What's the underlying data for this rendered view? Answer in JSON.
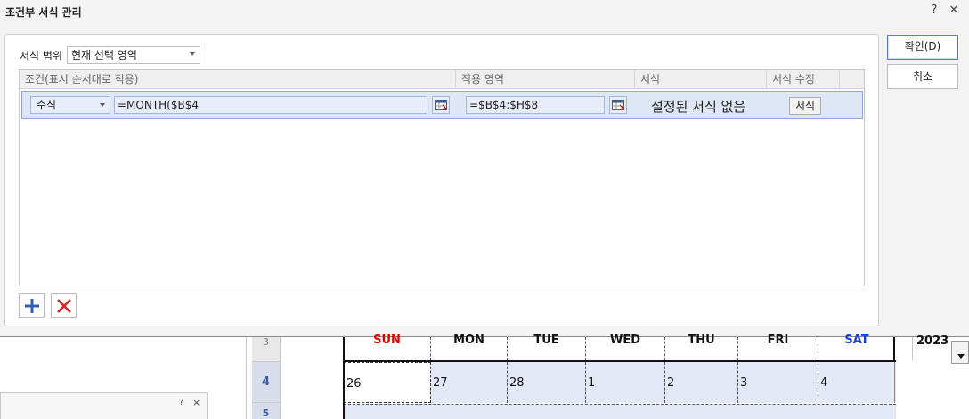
{
  "window": {
    "title": "조건부 서식 관리",
    "help": "?",
    "close": "✕"
  },
  "range": {
    "label": "서식 범위",
    "selected": "현재 선택 영역"
  },
  "table": {
    "headers": [
      "조건(표시 순서대로 적용)",
      "적용 영역",
      "서식",
      "서식 수정"
    ],
    "rule": {
      "condition_type": "수식",
      "formula": "=MONTH($B$4",
      "apply_range": "=$B$4:$H$8",
      "format_preview": "설정된 서식 없음",
      "format_button": "서식"
    }
  },
  "buttons": {
    "ok": "확인(D)",
    "cancel": "취소"
  },
  "sheet": {
    "row_numbers": [
      "3",
      "4",
      "5"
    ],
    "days": [
      "SUN",
      "MON",
      "TUE",
      "WED",
      "THU",
      "FRI",
      "SAT"
    ],
    "day_colors": [
      "#e00000",
      "#111111",
      "#111111",
      "#111111",
      "#111111",
      "#111111",
      "#1a3fd6"
    ],
    "dates": [
      "26",
      "27",
      "28",
      "1",
      "2",
      "3",
      "4"
    ],
    "year": "2023",
    "mini_pane": {
      "help": "?",
      "close": "×"
    }
  }
}
